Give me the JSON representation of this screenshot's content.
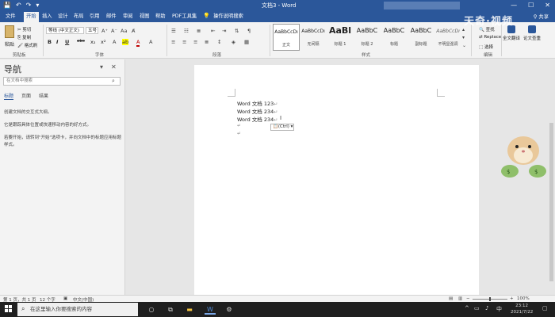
{
  "titlebar": {
    "title": "文档3 - Word",
    "qat": [
      "save-icon",
      "undo-icon",
      "redo-icon",
      "customize-icon"
    ],
    "qat_glyphs": [
      "💾",
      "↶",
      "↷",
      "▾"
    ],
    "window_controls": [
      "—",
      "☐",
      "✕"
    ]
  },
  "tabs": [
    "文件",
    "开始",
    "插入",
    "设计",
    "布局",
    "引用",
    "邮件",
    "审阅",
    "视图",
    "帮助",
    "PDF工具集"
  ],
  "active_tab": "开始",
  "tell_me": "操作说明搜索",
  "share": "共享",
  "ribbon": {
    "clipboard": {
      "label": "剪贴板",
      "paste": "粘贴",
      "cut": "剪切",
      "copy": "复制",
      "painter": "格式刷"
    },
    "font": {
      "label": "字体",
      "font_name": "等线 (中文正文)",
      "font_size": "五号",
      "buttons": [
        "B",
        "I",
        "U",
        "abc",
        "x₂",
        "x²"
      ]
    },
    "paragraph": {
      "label": "段落"
    },
    "styles": {
      "label": "样式",
      "items": [
        {
          "sample": "AaBbCcDı",
          "name": "正文",
          "active": true
        },
        {
          "sample": "AaBbCcDı",
          "name": "无间隔"
        },
        {
          "sample": "AaBl",
          "name": "标题 1"
        },
        {
          "sample": "AaBbC",
          "name": "标题 2"
        },
        {
          "sample": "AaBbC",
          "name": "标题"
        },
        {
          "sample": "AaBbC",
          "name": "副标题"
        },
        {
          "sample": "AaBbCcDı",
          "name": "不明显强调"
        }
      ]
    },
    "editing": {
      "label": "编辑",
      "find": "查找",
      "replace": "Replace",
      "select": "选择"
    },
    "right_tools": [
      {
        "label": "全文翻译"
      },
      {
        "label": "论文查重"
      }
    ]
  },
  "nav": {
    "title": "导航",
    "search_placeholder": "在文档中搜索",
    "tabs": [
      "标题",
      "页面",
      "结果"
    ],
    "active_tab": "标题",
    "messages": [
      "创建文档的交互式大纲。",
      "它是跟踪具体位置或快速移动内容的好方式。",
      "若要开始，请转到\"开始\"选项卡，并向文档中的标题应用标题样式。"
    ]
  },
  "document": {
    "lines": [
      "Word 文档 123",
      "Word 文档 234",
      "Word 文档 234"
    ],
    "paste_options": "(Ctrl)"
  },
  "watermark": "天奇·视频",
  "statusbar": {
    "page": "第 1 页，共 1 页",
    "words": "12 个字",
    "language": "中文(中国)",
    "zoom": "100%"
  },
  "taskbar": {
    "search_placeholder": "在这里输入你要搜索的内容",
    "time": "23:12",
    "date": "2021/7/22",
    "lang": "中"
  }
}
